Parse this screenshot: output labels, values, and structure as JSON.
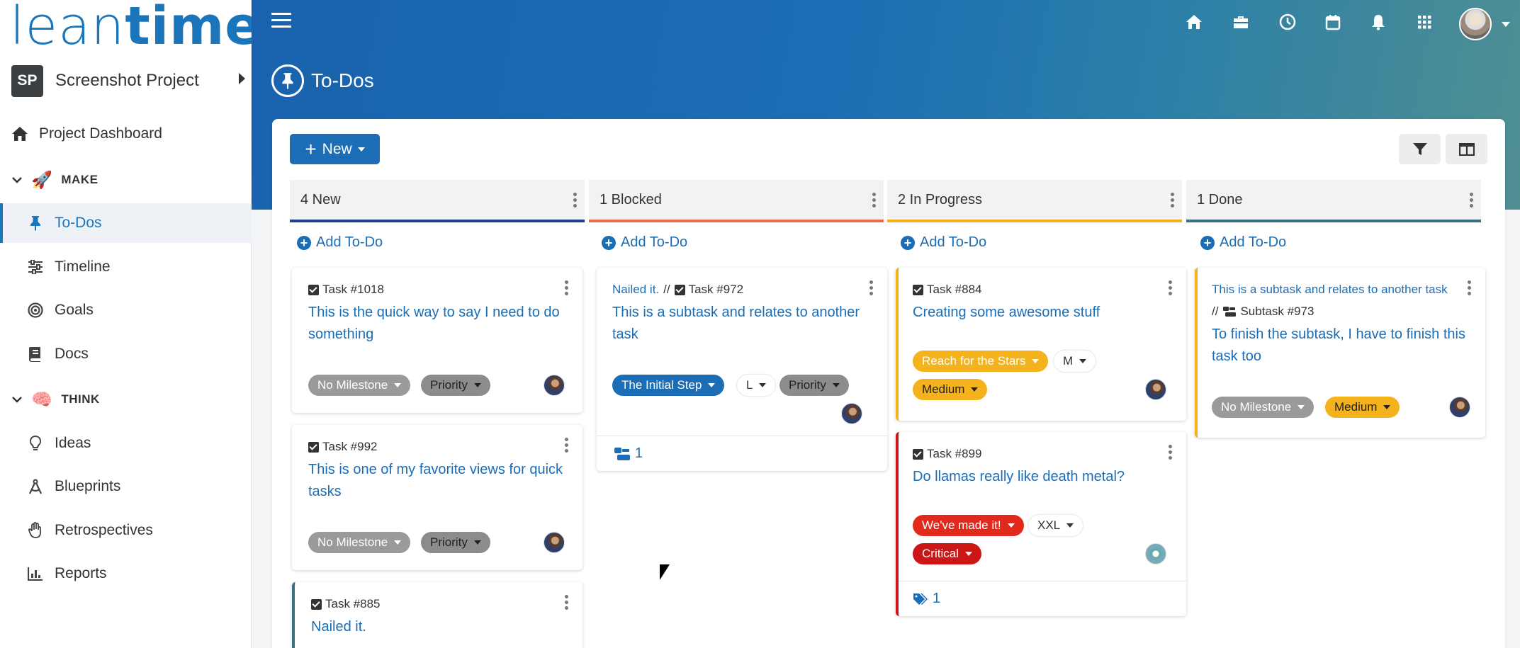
{
  "logo": {
    "part1": "lean",
    "part2": "time"
  },
  "sidebar": {
    "project_initials": "SP",
    "project_name": "Screenshot Project",
    "dashboard": "Project Dashboard",
    "section_make": "MAKE",
    "section_think": "THINK",
    "items": [
      {
        "label": "To-Dos",
        "icon": "pin-icon",
        "active": true
      },
      {
        "label": "Timeline",
        "icon": "sliders-icon"
      },
      {
        "label": "Goals",
        "icon": "target-icon"
      },
      {
        "label": "Docs",
        "icon": "book-icon"
      },
      {
        "label": "Ideas",
        "icon": "lightbulb-icon"
      },
      {
        "label": "Blueprints",
        "icon": "compass-icon"
      },
      {
        "label": "Retrospectives",
        "icon": "hand-icon"
      },
      {
        "label": "Reports",
        "icon": "chart-icon"
      }
    ]
  },
  "header": {
    "page_title": "To-Dos"
  },
  "toolbar": {
    "new_label": "New"
  },
  "columns": [
    {
      "title": "4 New",
      "add_label": "Add To-Do",
      "color": "#1f3f8f"
    },
    {
      "title": "1 Blocked",
      "add_label": "Add To-Do",
      "color": "#ee6c4d"
    },
    {
      "title": "2 In Progress",
      "add_label": "Add To-Do",
      "color": "#f4b21c"
    },
    {
      "title": "1 Done",
      "add_label": "Add To-Do",
      "color": "#3d6f7f"
    }
  ],
  "cards": {
    "c1018": {
      "num": "Task #1018",
      "title": "This is the quick way to say I need to do something",
      "milestone": "No Milestone",
      "priority": "Priority"
    },
    "c992": {
      "num": "Task #992",
      "title": "This is one of my favorite views for quick tasks",
      "milestone": "No Milestone",
      "priority": "Priority"
    },
    "c885": {
      "num": "Task #885",
      "title": "Nailed it."
    },
    "c972": {
      "parent": "Nailed it.",
      "sep": "//",
      "num": "Task #972",
      "title": "This is a subtask and relates to another task",
      "milestone": "The Initial Step",
      "size": "L",
      "priority": "Priority",
      "subtasks": "1"
    },
    "c884": {
      "num": "Task #884",
      "title": "Creating some awesome stuff",
      "milestone": "Reach for the Stars",
      "size": "M",
      "priority": "Medium"
    },
    "c899": {
      "num": "Task #899",
      "title": "Do llamas really like death metal?",
      "milestone": "We've made it!",
      "size": "XXL",
      "priority": "Critical",
      "tags": "1"
    },
    "c973": {
      "parent": "This is a subtask and relates to another task",
      "sep": "//",
      "num": "Subtask #973",
      "title": "To finish the subtask, I have to finish this task too",
      "milestone": "No Milestone",
      "priority": "Medium"
    }
  }
}
